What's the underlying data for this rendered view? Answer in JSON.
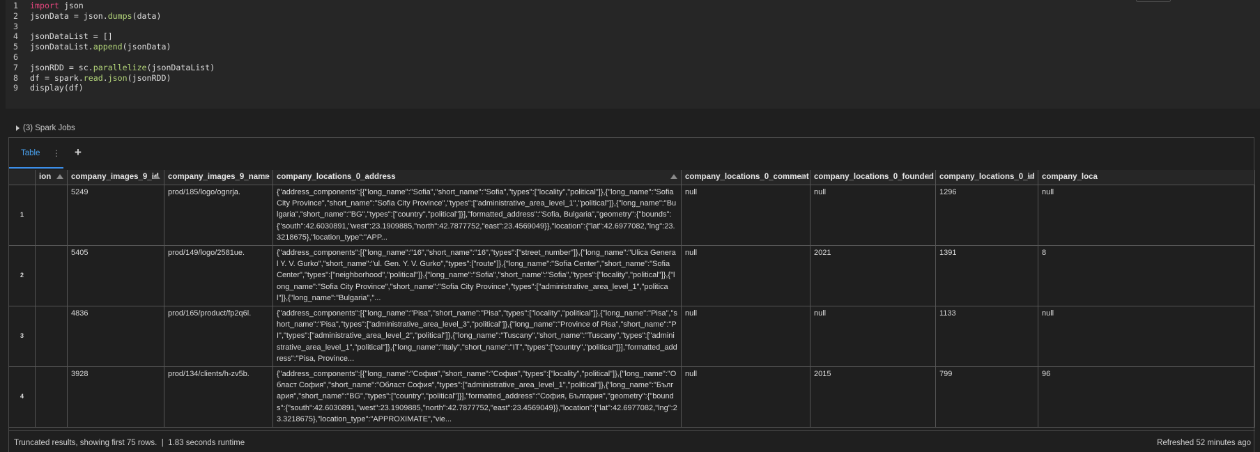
{
  "code": {
    "lines": [
      {
        "num": "1",
        "text": "import json"
      },
      {
        "num": "2",
        "text": "jsonData = json.dumps(data)"
      },
      {
        "num": "3",
        "text": ""
      },
      {
        "num": "4",
        "text": "jsonDataList = []"
      },
      {
        "num": "5",
        "text": "jsonDataList.append(jsonData)"
      },
      {
        "num": "6",
        "text": ""
      },
      {
        "num": "7",
        "text": "jsonRDD = sc.parallelize(jsonDataList)"
      },
      {
        "num": "8",
        "text": "df = spark.read.json(jsonRDD)"
      },
      {
        "num": "9",
        "text": "display(df)"
      }
    ],
    "keyword_color": "#e0457b",
    "function_color": "#b4d67a"
  },
  "spark_jobs": {
    "label": "(3) Spark Jobs"
  },
  "result": {
    "tab_label": "Table",
    "tab_menu_icon": "kebab-icon",
    "add_tab_icon": "plus-icon",
    "accent_color": "#4aa3f0",
    "columns": [
      "ion",
      "company_images_9_id",
      "company_images_9_name",
      "company_locations_0_address",
      "company_locations_0_comment",
      "company_locations_0_founded",
      "company_locations_0_id",
      "company_loca"
    ],
    "rows": [
      {
        "num": "1",
        "cells": [
          "",
          "5249",
          "prod/185/logo/ognrja.",
          "{\"address_components\":[{\"long_name\":\"Sofia\",\"short_name\":\"Sofia\",\"types\":[\"locality\",\"political\"]},{\"long_name\":\"Sofia City Province\",\"short_name\":\"Sofia City Province\",\"types\":[\"administrative_area_level_1\",\"political\"]},{\"long_name\":\"Bulgaria\",\"short_name\":\"BG\",\"types\":[\"country\",\"political\"]}],\"formatted_address\":\"Sofia, Bulgaria\",\"geometry\":{\"bounds\":{\"south\":42.6030891,\"west\":23.1909885,\"north\":42.7877752,\"east\":23.4569049}},\"location\":{\"lat\":42.6977082,\"lng\":23.3218675},\"location_type\":\"APP...",
          "null",
          "null",
          "1296",
          "null"
        ]
      },
      {
        "num": "2",
        "cells": [
          "",
          "5405",
          "prod/149/logo/2581ue.",
          "{\"address_components\":[{\"long_name\":\"16\",\"short_name\":\"16\",\"types\":[\"street_number\"]},{\"long_name\":\"Ulica General Y. V. Gurko\",\"short_name\":\"ul. Gen. Y. V. Gurko\",\"types\":[\"route\"]},{\"long_name\":\"Sofia Center\",\"short_name\":\"Sofia Center\",\"types\":[\"neighborhood\",\"political\"]},{\"long_name\":\"Sofia\",\"short_name\":\"Sofia\",\"types\":[\"locality\",\"political\"]},{\"long_name\":\"Sofia City Province\",\"short_name\":\"Sofia City Province\",\"types\":[\"administrative_area_level_1\",\"political\"]},{\"long_name\":\"Bulgaria\",\"...",
          "null",
          "2021",
          "1391",
          "8"
        ]
      },
      {
        "num": "3",
        "cells": [
          "",
          "4836",
          "prod/165/product/fp2q6l.",
          "{\"address_components\":[{\"long_name\":\"Pisa\",\"short_name\":\"Pisa\",\"types\":[\"locality\",\"political\"]},{\"long_name\":\"Pisa\",\"short_name\":\"Pisa\",\"types\":[\"administrative_area_level_3\",\"political\"]},{\"long_name\":\"Province of Pisa\",\"short_name\":\"PI\",\"types\":[\"administrative_area_level_2\",\"political\"]},{\"long_name\":\"Tuscany\",\"short_name\":\"Tuscany\",\"types\":[\"administrative_area_level_1\",\"political\"]},{\"long_name\":\"Italy\",\"short_name\":\"IT\",\"types\":[\"country\",\"political\"]}],\"formatted_address\":\"Pisa, Province...",
          "null",
          "null",
          "1133",
          "null"
        ]
      },
      {
        "num": "4",
        "cells": [
          "",
          "3928",
          "prod/134/clients/h-zv5b.",
          "{\"address_components\":[{\"long_name\":\"София\",\"short_name\":\"София\",\"types\":[\"locality\",\"political\"]},{\"long_name\":\"Област София\",\"short_name\":\"Област София\",\"types\":[\"administrative_area_level_1\",\"political\"]},{\"long_name\":\"България\",\"short_name\":\"BG\",\"types\":[\"country\",\"political\"]}],\"formatted_address\":\"София, България\",\"geometry\":{\"bounds\":{\"south\":42.6030891,\"west\":23.1909885,\"north\":42.7877752,\"east\":23.4569049}},\"location\":{\"lat\":42.6977082,\"lng\":23.3218675},\"location_type\":\"APPROXIMATE\",\"vie...",
          "null",
          "2015",
          "799",
          "96"
        ]
      }
    ]
  },
  "footer": {
    "left": "Truncated results, showing first 75 rows.  |  1.83 seconds runtime",
    "right": "Refreshed 52 minutes ago"
  }
}
